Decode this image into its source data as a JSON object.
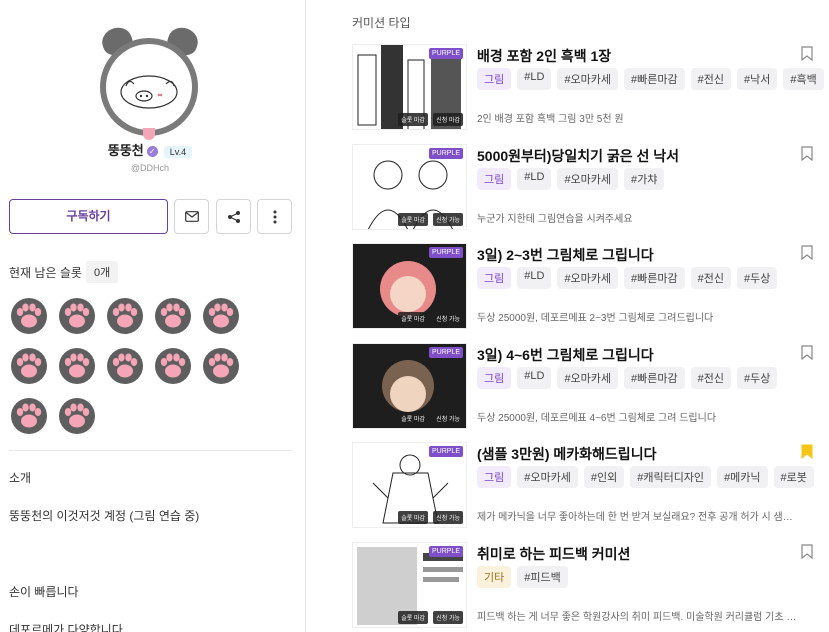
{
  "profile": {
    "name": "뚱뚱천",
    "level": "Lv.4",
    "handle": "@DDHch",
    "subscribe_label": "구독하기"
  },
  "slots": {
    "label": "현재 남은 슬롯",
    "count": "0개",
    "paw_count": 12
  },
  "intro": {
    "title": "소개",
    "line1": "뚱뚱천의 이것저것 계정 (그림 연습 중)",
    "line2": "손이 빠릅니다",
    "line3": "데포르메가 다양합니다"
  },
  "commission": {
    "section_title": "커미션 타입",
    "badge": "PURPLE",
    "mini_labels": [
      "슬롯 마감",
      "신청 마감",
      "신청 가능"
    ],
    "cards": [
      {
        "title": "배경 포함 2인 흑백 1장",
        "tags": [
          "그림",
          "#LD",
          "#오마카세",
          "#빠른마감",
          "#전신",
          "#낙서",
          "#흑백"
        ],
        "desc": "2인 배경 포함 흑백 그림 3만 5천 원",
        "status": [
          "슬롯 마감",
          "신청 마감"
        ],
        "bookmarked": false
      },
      {
        "title": "5000원부터)당일치기 굵은 선 낙서",
        "tags": [
          "그림",
          "#LD",
          "#오마카세",
          "#가챠"
        ],
        "desc": "누군가 지한테 그림연습을 시켜주세요",
        "status": [
          "슬롯 마감",
          "신청 가능"
        ],
        "bookmarked": false
      },
      {
        "title": "3일) 2~3번 그림체로 그립니다",
        "tags": [
          "그림",
          "#LD",
          "#오마카세",
          "#빠른마감",
          "#전신",
          "#두상"
        ],
        "desc": "두상 25000원, 데포르메표 2~3번 그림체로 그려드립니다",
        "status": [
          "슬롯 마감",
          "신청 가능"
        ],
        "bookmarked": false
      },
      {
        "title": "3일) 4~6번 그림체로 그립니다",
        "tags": [
          "그림",
          "#LD",
          "#오마카세",
          "#빠른마감",
          "#전신",
          "#두상"
        ],
        "desc": "두상 25000원, 데포르메표 4~6번 그림체로 그려 드립니다",
        "status": [
          "슬롯 마감",
          "신청 가능"
        ],
        "bookmarked": false
      },
      {
        "title": "(샘플 3만원) 메카화해드립니다",
        "tags": [
          "그림",
          "#오마카세",
          "#인외",
          "#캐릭터디자인",
          "#메카닉",
          "#로봇"
        ],
        "desc": "제가 메카닉을 너무 좋아하는데 한 번 받겨 보실래요? 전후 공개 허가 시 샘…",
        "status": [
          "슬롯 마감",
          "신청 가능"
        ],
        "bookmarked": true
      },
      {
        "title": "취미로 하는 피드백 커미션",
        "tags": [
          "기타",
          "#피드백"
        ],
        "desc": "피드백 하는 게 너무 좋은 학원강사의 취미 피드백. 미술학원 커리큘럼 기초 …",
        "status": [
          "슬롯 마감",
          "신청 가능"
        ],
        "bookmarked": false
      }
    ]
  },
  "colors": {
    "accent": "#6a3fa0",
    "purple_badge": "#7e4fc9",
    "bookmark_active": "#f5c518",
    "paw_pink": "#f4a6b7",
    "paw_gray": "#5e5e5e"
  }
}
